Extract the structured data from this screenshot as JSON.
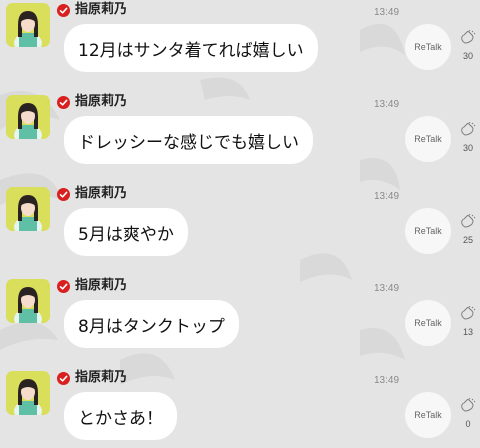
{
  "feed": {
    "posts": [
      {
        "author": "指原莉乃",
        "time": "13:49",
        "text": "12月はサンタ着てれば嬉しい",
        "retalk_label": "ReTalk",
        "reaction_count": "30"
      },
      {
        "author": "指原莉乃",
        "time": "13:49",
        "text": "ドレッシーな感じでも嬉しい",
        "retalk_label": "ReTalk",
        "reaction_count": "30"
      },
      {
        "author": "指原莉乃",
        "time": "13:49",
        "text": "5月は爽やか",
        "retalk_label": "ReTalk",
        "reaction_count": "25"
      },
      {
        "author": "指原莉乃",
        "time": "13:49",
        "text": "8月はタンクトップ",
        "retalk_label": "ReTalk",
        "reaction_count": "13"
      },
      {
        "author": "指原莉乃",
        "time": "13:49",
        "text": "とかさあ！",
        "retalk_label": "ReTalk",
        "reaction_count": "0"
      }
    ]
  },
  "icons": {
    "verified": "verified-check-icon",
    "reaction": "hand-clap-icon"
  },
  "colors": {
    "background": "#e4e4e4",
    "bubble": "#ffffff",
    "verified_badge": "#d8201f",
    "avatar_bg": "#d9df5a"
  }
}
